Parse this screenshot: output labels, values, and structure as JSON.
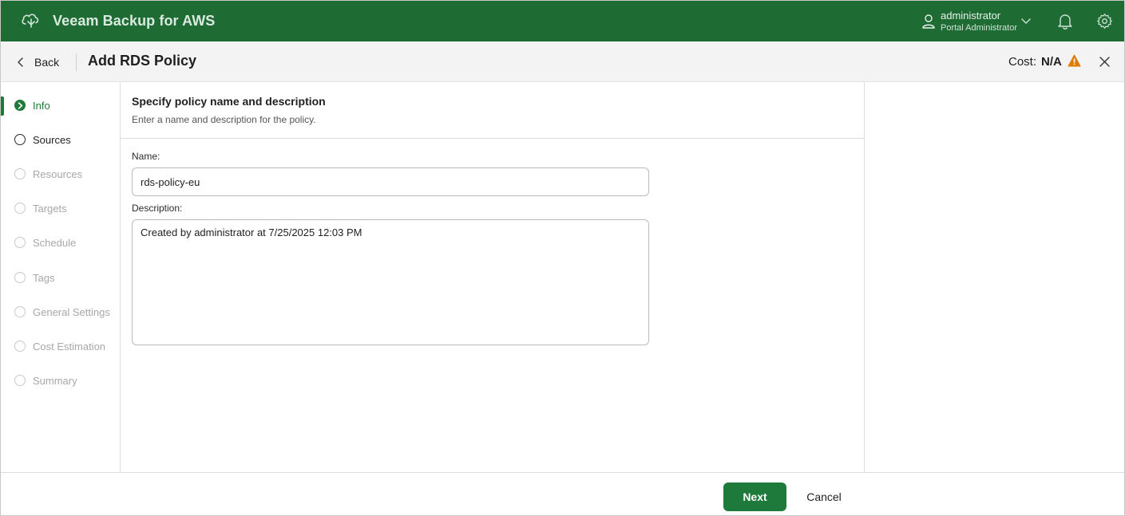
{
  "app": {
    "title": "Veeam Backup for AWS"
  },
  "user": {
    "name": "administrator",
    "role": "Portal Administrator"
  },
  "header": {
    "back_label": "Back",
    "title": "Add RDS Policy",
    "cost_label": "Cost:",
    "cost_value": "N/A"
  },
  "steps": [
    {
      "label": "Info",
      "state": "active"
    },
    {
      "label": "Sources",
      "state": "next"
    },
    {
      "label": "Resources",
      "state": "disabled"
    },
    {
      "label": "Targets",
      "state": "disabled"
    },
    {
      "label": "Schedule",
      "state": "disabled"
    },
    {
      "label": "Tags",
      "state": "disabled"
    },
    {
      "label": "General Settings",
      "state": "disabled"
    },
    {
      "label": "Cost Estimation",
      "state": "disabled"
    },
    {
      "label": "Summary",
      "state": "disabled"
    }
  ],
  "form": {
    "section_title": "Specify policy name and description",
    "section_subtitle": "Enter a name and description for the policy.",
    "name_label": "Name:",
    "name_value": "rds-policy-eu",
    "description_label": "Description:",
    "description_value": "Created by administrator at 7/25/2025 12:03 PM"
  },
  "footer": {
    "next_label": "Next",
    "cancel_label": "Cancel"
  },
  "colors": {
    "brand_green": "#1e6b34",
    "accent_green": "#1e7a3a",
    "warning_orange": "#e07b00"
  }
}
